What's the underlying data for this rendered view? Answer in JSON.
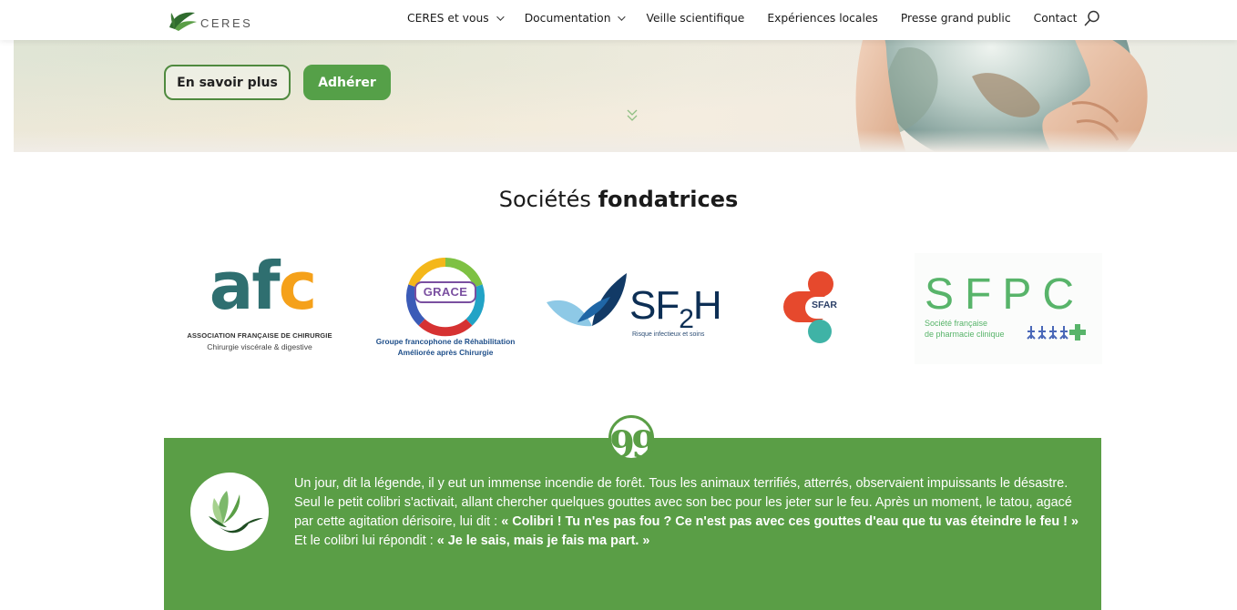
{
  "header": {
    "logo_text": "CERES",
    "nav": [
      {
        "label": "CERES et vous",
        "has_dropdown": true
      },
      {
        "label": "Documentation",
        "has_dropdown": true
      },
      {
        "label": "Veille scientifique",
        "has_dropdown": false
      },
      {
        "label": "Expériences locales",
        "has_dropdown": false
      },
      {
        "label": "Presse grand public",
        "has_dropdown": false
      },
      {
        "label": "Contact",
        "has_dropdown": false
      }
    ],
    "search_icon": "search-icon"
  },
  "hero": {
    "btn_more": "En savoir plus",
    "btn_join": "Adhérer",
    "scroll_icon": "double-chevron-down-icon"
  },
  "section": {
    "title_light": "Sociétés",
    "title_bold": "fondatrices"
  },
  "logos": {
    "afc": {
      "letters_a": "af",
      "letters_c": "c",
      "line1": "ASSOCIATION FRANÇAISE DE CHIRURGIE",
      "line2": "Chirurgie viscérale & digestive"
    },
    "grace": {
      "word": "GRACE",
      "line1": "Groupe francophone de Réhabilitation",
      "line2": "Améliorée après Chirurgie"
    },
    "sf2h": {
      "word_sf": "SF",
      "word_2": "2",
      "word_h": "H",
      "subtitle": "Risque infectieux et soins"
    },
    "sfar": {
      "word": "SFAR"
    },
    "sfpc": {
      "word": "SFPC",
      "line1": "Société française",
      "line2": "de pharmacie clinique"
    }
  },
  "quote": {
    "icon": "quote-icon",
    "badge": "99",
    "p1": "Un jour, dit la légende, il y eut un immense incendie de forêt. Tous les animaux terrifiés, atterrés, observaient impuissants le désastre. Seul le petit colibri s'activait, allant chercher quelques gouttes avec son bec pour les jeter sur le feu. Après un moment, le tatou, agacé par cette agitation dérisoire, lui dit : ",
    "p1_bold": "« Colibri ! Tu n'es pas fou ? Ce n'est pas avec ces gouttes d'eau que tu vas éteindre le feu ! »",
    "p2": "Et le colibri lui répondit : ",
    "p2_bold": "« Je le sais, mais je fais ma part. »"
  },
  "colors": {
    "brand_green": "#5a9e46",
    "button_green": "#55a048"
  }
}
